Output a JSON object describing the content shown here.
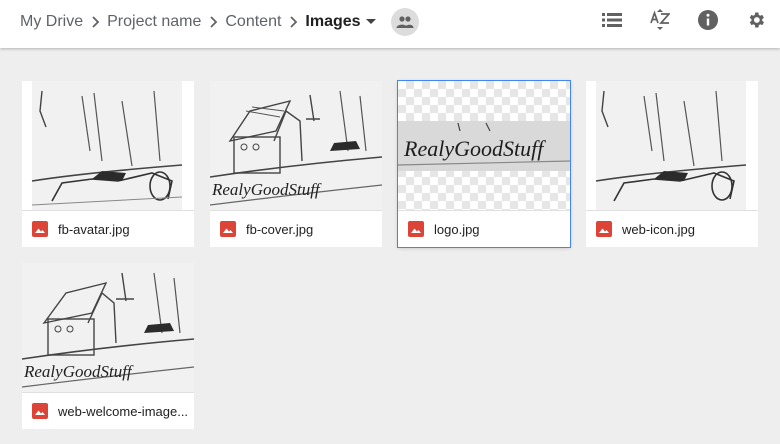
{
  "breadcrumb": {
    "items": [
      "My Drive",
      "Project name",
      "Content"
    ],
    "current": "Images"
  },
  "toolbar": {
    "icons": [
      "list-view-icon",
      "sort-az-icon",
      "info-icon",
      "settings-icon"
    ]
  },
  "colors": {
    "accent": "#4285f4",
    "image_file_icon": "#db4437",
    "background": "#eeeeee"
  },
  "files": [
    {
      "name": "fb-avatar.jpg",
      "selected": false
    },
    {
      "name": "fb-cover.jpg",
      "selected": false
    },
    {
      "name": "logo.jpg",
      "selected": true
    },
    {
      "name": "web-icon.jpg",
      "selected": false
    },
    {
      "name": "web-welcome-image..."
    }
  ],
  "thumbnail_text": "RealyGoodStuff"
}
